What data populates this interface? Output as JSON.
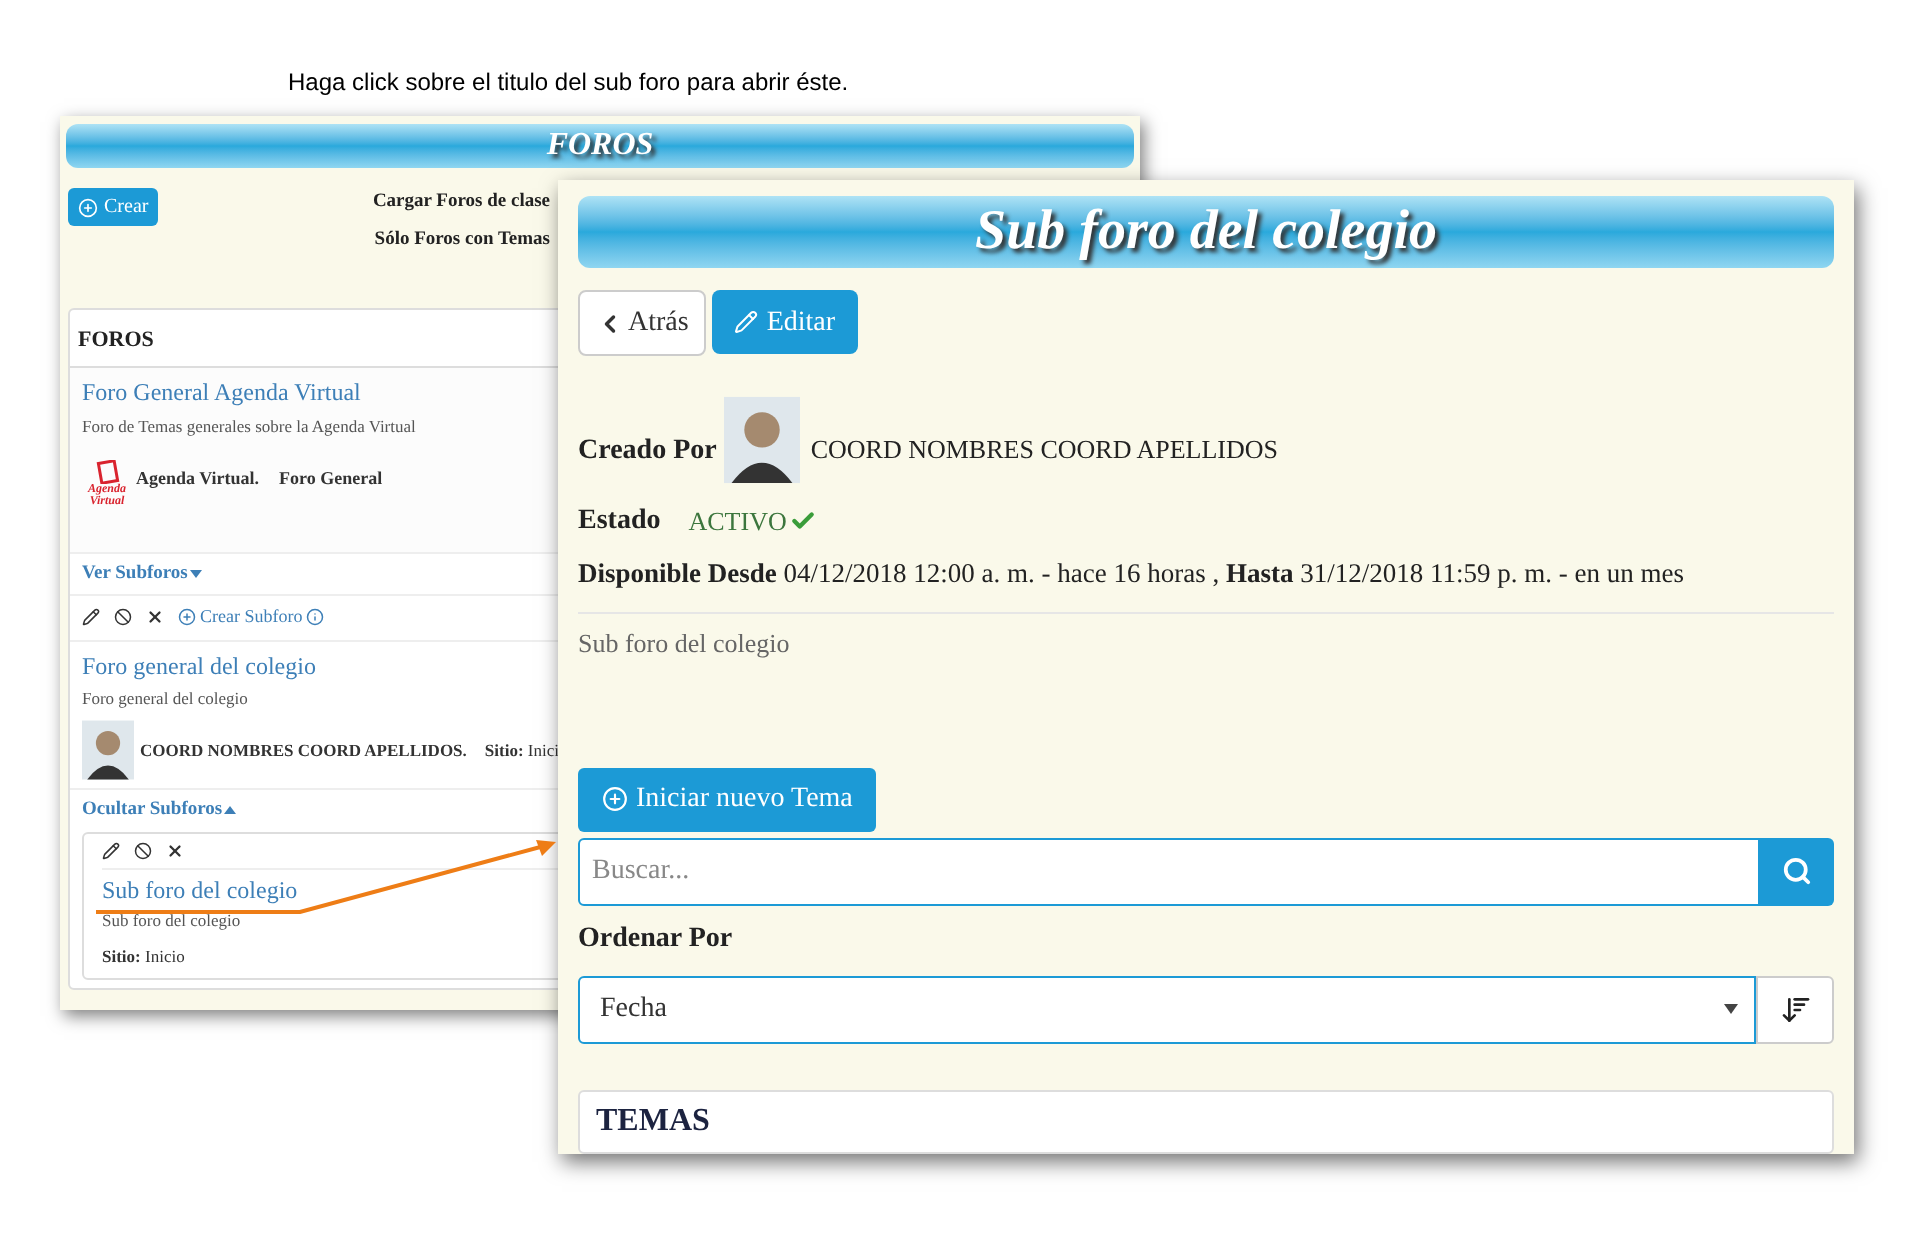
{
  "caption": "Haga click sobre el titulo del sub foro para abrir éste.",
  "back_window": {
    "title": "FOROS",
    "create_button": "Crear",
    "filters": [
      "Cargar Foros de clase",
      "Sólo Foros con Temas"
    ],
    "panel_title": "FOROS",
    "forum": {
      "title": "Foro General Agenda Virtual",
      "description": "Foro de Temas generales sobre la Agenda Virtual",
      "logo_text": "Agenda Virtual",
      "site": "Agenda Virtual.",
      "category": "Foro General"
    },
    "show_subforums": "Ver Subforos",
    "create_subforum": "Crear Subforo",
    "subforum": {
      "title": "Foro general del colegio",
      "description": "Foro general del colegio",
      "author": "COORD NOMBRES COORD APELLIDOS.",
      "site_label": "Sitio:",
      "site_value": "Inici"
    },
    "hide_subforums": "Ocultar Subforos",
    "nested": {
      "title": "Sub foro del colegio",
      "description": "Sub foro del colegio",
      "site_label": "Sitio:",
      "site_value": "Inicio"
    }
  },
  "front_window": {
    "title": "Sub foro del colegio",
    "back_button": "Atrás",
    "edit_button": "Editar",
    "created_by_label": "Creado Por",
    "author": "COORD NOMBRES COORD APELLIDOS",
    "status_label": "Estado",
    "status": "ACTIVO",
    "available": "**Disponible Desde** 04/12/2018 12:00 a. m. - hace 16 horas , **Hasta** 31/12/2018 11:59 p. m. - en un mes",
    "description": "Sub foro del colegio",
    "new_topic_button": "Iniciar nuevo Tema",
    "search": {
      "placeholder": "Buscar..."
    },
    "sort_label": "Ordenar Por",
    "sort": {
      "value": "Fecha"
    },
    "topics_title": "TEMAS"
  }
}
